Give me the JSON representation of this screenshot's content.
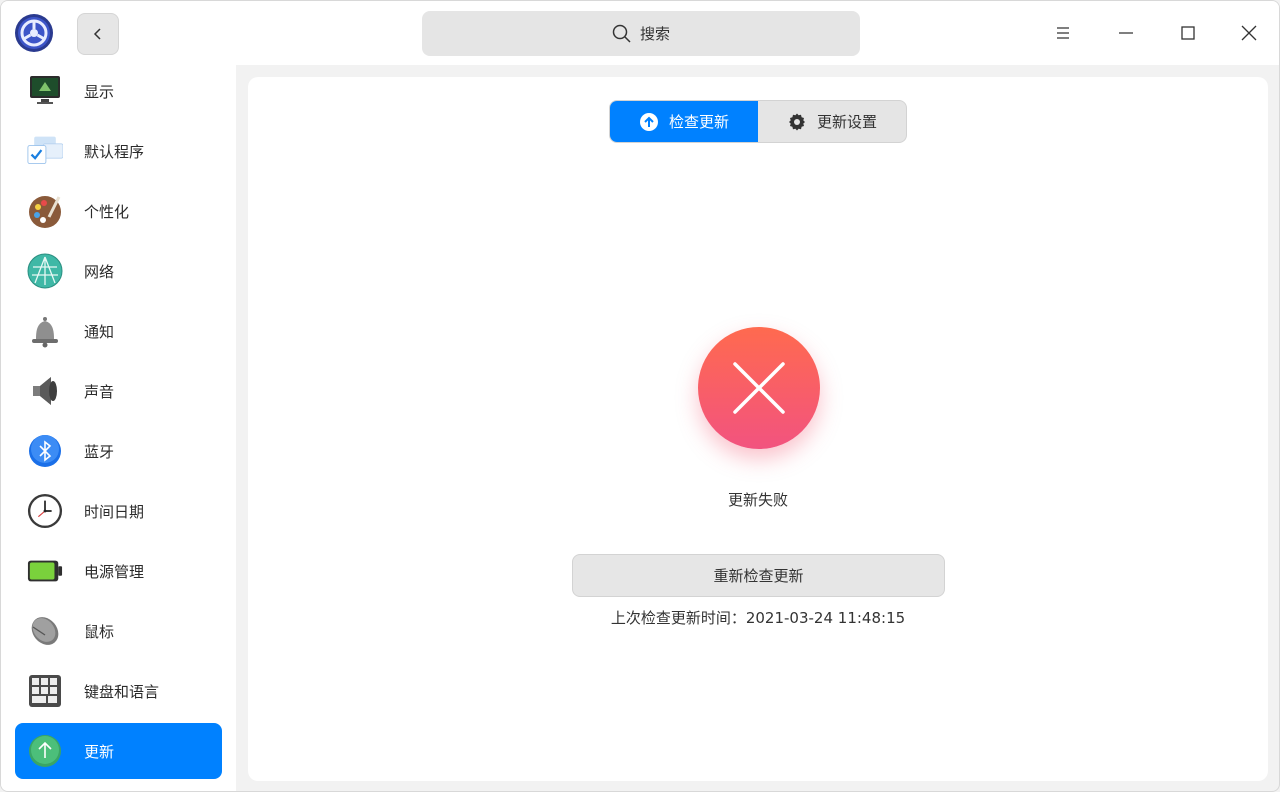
{
  "titlebar": {
    "search_placeholder": "搜索"
  },
  "sidebar": {
    "items": [
      {
        "label": "显示",
        "icon": "display-icon"
      },
      {
        "label": "默认程序",
        "icon": "default-apps-icon"
      },
      {
        "label": "个性化",
        "icon": "personalization-icon"
      },
      {
        "label": "网络",
        "icon": "network-icon"
      },
      {
        "label": "通知",
        "icon": "bell-icon"
      },
      {
        "label": "声音",
        "icon": "speaker-icon"
      },
      {
        "label": "蓝牙",
        "icon": "bluetooth-icon"
      },
      {
        "label": "时间日期",
        "icon": "clock-icon"
      },
      {
        "label": "电源管理",
        "icon": "battery-icon"
      },
      {
        "label": "鼠标",
        "icon": "mouse-icon"
      },
      {
        "label": "键盘和语言",
        "icon": "keyboard-icon"
      },
      {
        "label": "更新",
        "icon": "update-icon",
        "active": true
      }
    ]
  },
  "main": {
    "tabs": [
      {
        "label": "检查更新",
        "active": true
      },
      {
        "label": "更新设置",
        "active": false
      }
    ],
    "status": "更新失败",
    "retry_label": "重新检查更新",
    "last_check": "上次检查更新时间：2021-03-24 11:48:15"
  },
  "colors": {
    "accent": "#0081ff",
    "error_top": "#ff6a4f",
    "error_bottom": "#f2537f"
  }
}
